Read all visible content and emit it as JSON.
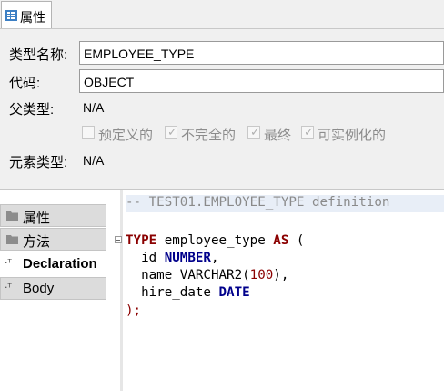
{
  "tab": {
    "label": "属性",
    "icon": "properties-icon"
  },
  "form": {
    "type_name": {
      "label": "类型名称:",
      "value": "EMPLOYEE_TYPE"
    },
    "code": {
      "label": "代码:",
      "value": "OBJECT"
    },
    "parent_type": {
      "label": "父类型:",
      "value": "N/A"
    },
    "flags": [
      {
        "label": "预定义的",
        "checked": false
      },
      {
        "label": "不完全的",
        "checked": true
      },
      {
        "label": "最终",
        "checked": true
      },
      {
        "label": "可实例化的",
        "checked": true
      }
    ],
    "element_type": {
      "label": "元素类型:",
      "value": "N/A"
    }
  },
  "sidebar": {
    "items": [
      {
        "label": "属性",
        "icon": "folder-icon"
      },
      {
        "label": "方法",
        "icon": "folder-icon"
      },
      {
        "label": "Declaration",
        "icon": "declaration-icon",
        "active": true
      },
      {
        "label": "Body",
        "icon": "body-icon"
      }
    ]
  },
  "editor": {
    "comment": "-- TEST01.EMPLOYEE_TYPE definition",
    "kw_type": "TYPE",
    "type_name": " employee_type ",
    "kw_as": "AS",
    "open_paren": " (",
    "f1_name": "  id ",
    "f1_type": "NUMBER",
    "f1_end": ",",
    "f2_pre": "  name VARCHAR2(",
    "f2_num": "100",
    "f2_end": "),",
    "f3_name": "  hire_date ",
    "f3_type": "DATE",
    "close": ");"
  },
  "colors": {
    "keyword": "#8b0000",
    "type": "#00008b",
    "comment": "#8a8a8a",
    "highlight": "#e8eef7"
  }
}
